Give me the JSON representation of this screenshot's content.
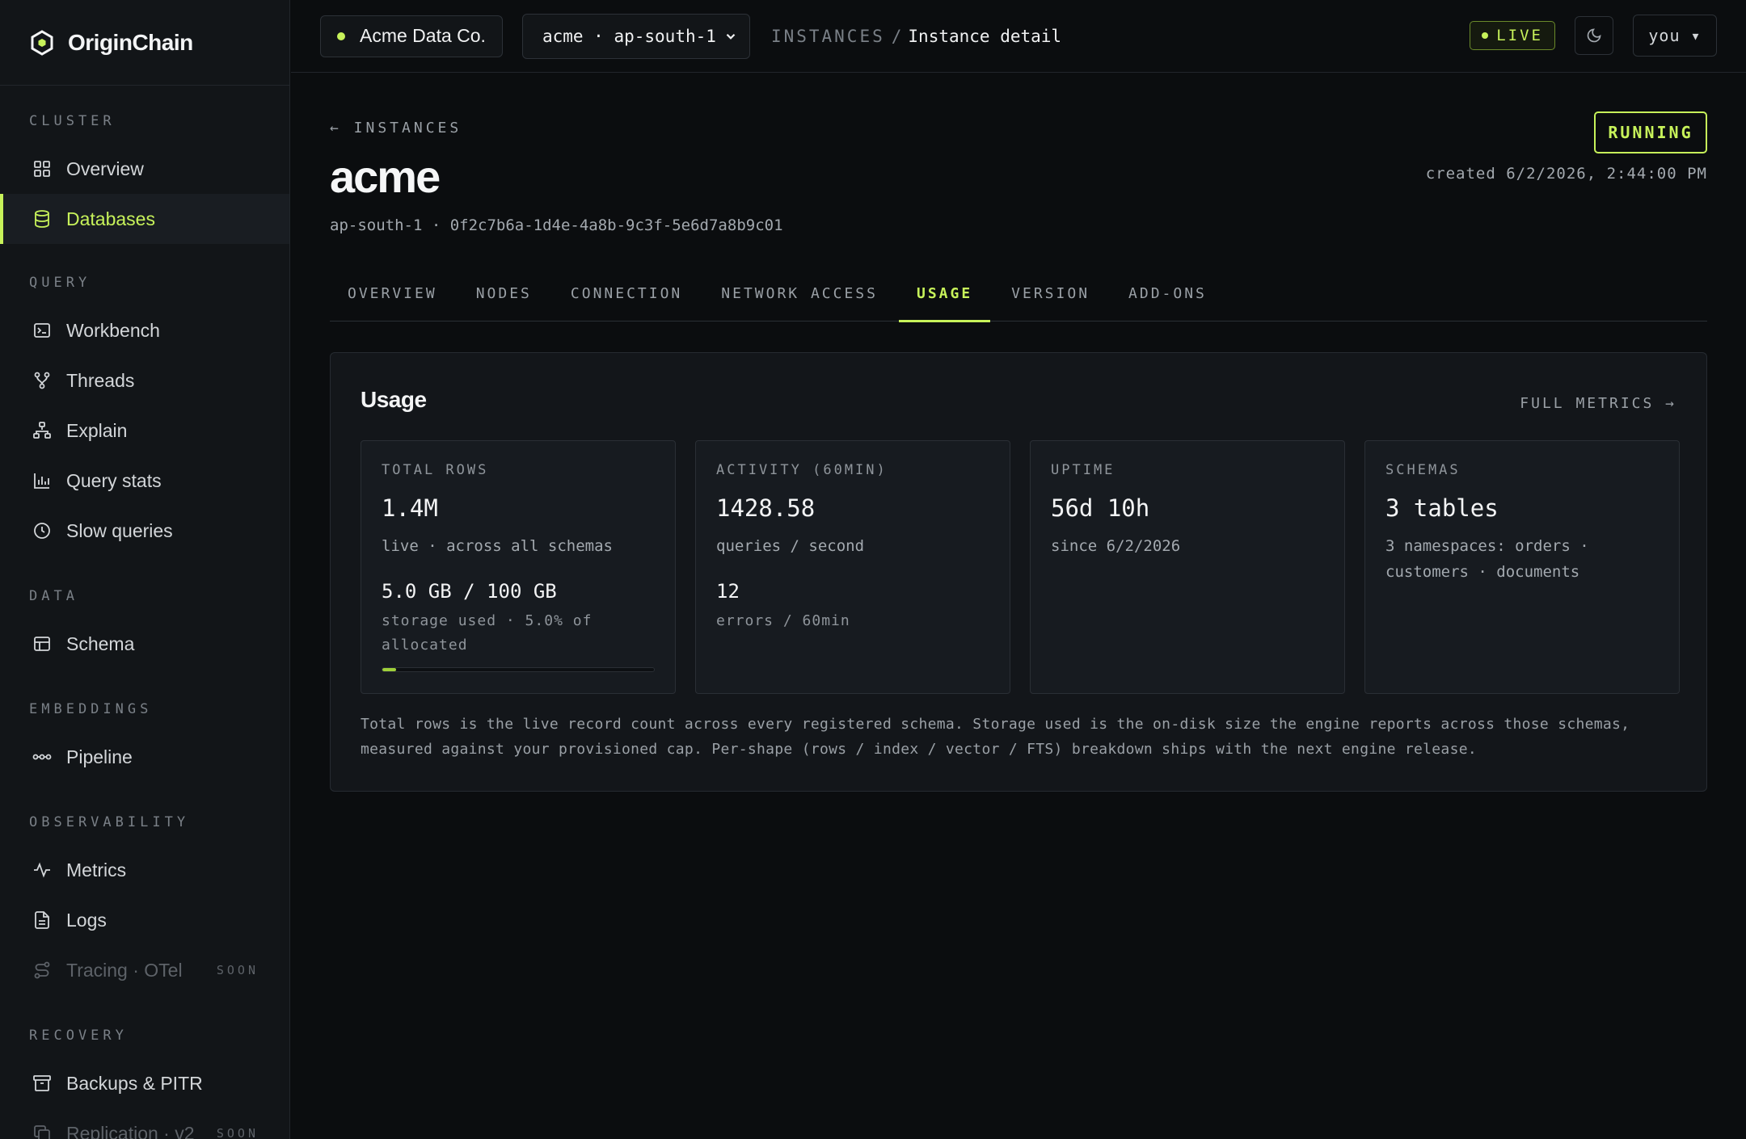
{
  "brand": {
    "name": "OriginChain"
  },
  "sidebar": {
    "sections": [
      {
        "title": "CLUSTER",
        "items": [
          {
            "label": "Overview",
            "icon": "grid-icon"
          },
          {
            "label": "Databases",
            "icon": "database-icon",
            "active": true
          }
        ]
      },
      {
        "title": "QUERY",
        "items": [
          {
            "label": "Workbench",
            "icon": "terminal-icon"
          },
          {
            "label": "Threads",
            "icon": "branch-icon"
          },
          {
            "label": "Explain",
            "icon": "tree-icon"
          },
          {
            "label": "Query stats",
            "icon": "bar-chart-icon"
          },
          {
            "label": "Slow queries",
            "icon": "clock-icon"
          }
        ]
      },
      {
        "title": "DATA",
        "items": [
          {
            "label": "Schema",
            "icon": "table-icon"
          }
        ]
      },
      {
        "title": "EMBEDDINGS",
        "items": [
          {
            "label": "Pipeline",
            "icon": "pipeline-icon"
          }
        ]
      },
      {
        "title": "OBSERVABILITY",
        "items": [
          {
            "label": "Metrics",
            "icon": "pulse-icon"
          },
          {
            "label": "Logs",
            "icon": "file-icon"
          },
          {
            "label": "Tracing · OTel",
            "icon": "route-icon",
            "badge": "SOON"
          }
        ]
      },
      {
        "title": "RECOVERY",
        "items": [
          {
            "label": "Backups & PITR",
            "icon": "archive-icon"
          },
          {
            "label": "Replication · v2",
            "icon": "copy-icon",
            "badge": "SOON"
          }
        ]
      }
    ]
  },
  "topbar": {
    "org": "Acme Data Co.",
    "region": "acme · ap-south-1",
    "crumb_section": "INSTANCES",
    "crumb_sep": "/",
    "crumb_page": "Instance detail",
    "live": "LIVE",
    "user": "you ▾"
  },
  "instance": {
    "back": "← INSTANCES",
    "name": "acme",
    "subline": "ap-south-1 · 0f2c7b6a-1d4e-4a8b-9c3f-5e6d7a8b9c01",
    "status": "RUNNING",
    "created": "created 6/2/2026, 2:44:00 PM"
  },
  "tabs": [
    "OVERVIEW",
    "NODES",
    "CONNECTION",
    "NETWORK ACCESS",
    "USAGE",
    "VERSION",
    "ADD-ONS"
  ],
  "usage": {
    "title": "Usage",
    "full_metrics": "FULL METRICS →",
    "stats": [
      {
        "label": "TOTAL ROWS",
        "value": "1.4M",
        "desc": "live · across all schemas",
        "value2": "5.0 GB / 100 GB",
        "desc2": "storage used · 5.0% of allocated",
        "progress": 0.05
      },
      {
        "label": "ACTIVITY (60MIN)",
        "value": "1428.58",
        "desc": "queries / second",
        "value2": "12",
        "desc2": "errors / 60min"
      },
      {
        "label": "UPTIME",
        "value": "56d 10h",
        "desc": "since 6/2/2026"
      },
      {
        "label": "SCHEMAS",
        "value": "3 tables",
        "desc": "3 namespaces: orders · customers · documents"
      }
    ],
    "footnote": "Total rows is the live record count across every registered schema. Storage used is the on-disk size the engine reports across those schemas, measured against your provisioned cap. Per-shape (rows / index / vector / FTS) breakdown ships with the next engine release."
  },
  "colors": {
    "accent": "#c7f25a",
    "background": "#0b0d0f",
    "sidebar": "#121518"
  }
}
